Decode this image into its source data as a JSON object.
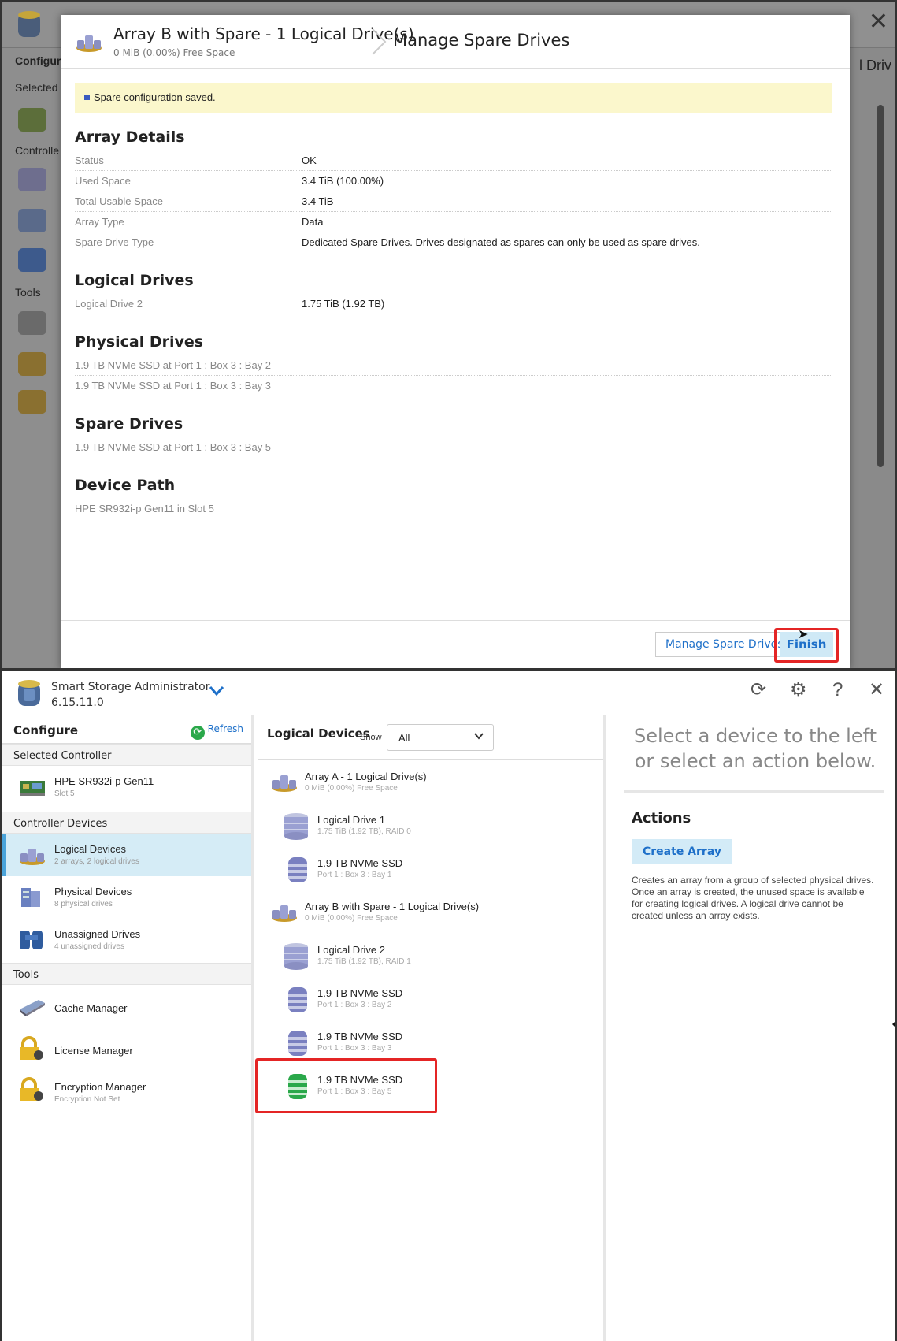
{
  "modal": {
    "title": "Array B with Spare - 1 Logical Drive(s)",
    "subtitle": "0 MiB (0.00%) Free Space",
    "step": "Manage Spare Drives",
    "notice": "Spare configuration saved.",
    "sections": {
      "array_details": "Array Details",
      "logical_drives": "Logical Drives",
      "physical_drives": "Physical Drives",
      "spare_drives": "Spare Drives",
      "device_path": "Device Path"
    },
    "details": [
      {
        "k": "Status",
        "v": "OK"
      },
      {
        "k": "Used Space",
        "v": "3.4 TiB (100.00%)"
      },
      {
        "k": "Total Usable Space",
        "v": "3.4 TiB"
      },
      {
        "k": "Array Type",
        "v": "Data"
      },
      {
        "k": "Spare Drive Type",
        "v": "Dedicated Spare Drives. Drives designated as spares can only be used as spare drives."
      }
    ],
    "logical": [
      {
        "k": "Logical Drive 2",
        "v": "1.75 TiB (1.92 TB)"
      }
    ],
    "physical": [
      "1.9 TB NVMe SSD at Port 1 : Box 3 : Bay 2",
      "1.9 TB NVMe SSD at Port 1 : Box 3 : Bay 3"
    ],
    "spare": [
      "1.9 TB NVMe SSD at Port 1 : Box 3 : Bay 5"
    ],
    "device_path": "HPE SR932i-p Gen11 in Slot 5",
    "buttons": {
      "manage": "Manage Spare Drives",
      "finish": "Finish"
    }
  },
  "background": {
    "header_left": "Configur",
    "selected": "Selected",
    "controller": "Controlle",
    "tools": "Tools",
    "right_text": "l Driv"
  },
  "app": {
    "name": "Smart Storage Administrator",
    "version": "6.15.11.0",
    "left": {
      "title": "Configure",
      "refresh": "Refresh",
      "selected_controller": "Selected Controller",
      "controller": {
        "name": "HPE SR932i-p Gen11",
        "desc": "Slot 5"
      },
      "controller_devices": "Controller Devices",
      "devices": [
        {
          "name": "Logical Devices",
          "desc": "2 arrays, 2 logical drives"
        },
        {
          "name": "Physical Devices",
          "desc": "8 physical drives"
        },
        {
          "name": "Unassigned Drives",
          "desc": "4 unassigned drives"
        }
      ],
      "tools_title": "Tools",
      "tools": [
        {
          "name": "Cache Manager",
          "desc": ""
        },
        {
          "name": "License Manager",
          "desc": ""
        },
        {
          "name": "Encryption Manager",
          "desc": "Encryption Not Set"
        }
      ]
    },
    "mid": {
      "title": "Logical Devices",
      "show": "Show",
      "filter": "All",
      "items": [
        {
          "name": "Array A - 1 Logical Drive(s)",
          "desc": "0 MiB (0.00%) Free Space"
        },
        {
          "name": "Logical Drive 1",
          "desc": "1.75 TiB (1.92 TB), RAID 0"
        },
        {
          "name": "1.9 TB NVMe SSD",
          "desc": "Port 1 : Box 3 : Bay 1"
        },
        {
          "name": "Array B with Spare - 1 Logical Drive(s)",
          "desc": "0 MiB (0.00%) Free Space"
        },
        {
          "name": "Logical Drive 2",
          "desc": "1.75 TiB (1.92 TB), RAID 1"
        },
        {
          "name": "1.9 TB NVMe SSD",
          "desc": "Port 1 : Box 3 : Bay 2"
        },
        {
          "name": "1.9 TB NVMe SSD",
          "desc": "Port 1 : Box 3 : Bay 3"
        },
        {
          "name": "1.9 TB NVMe SSD",
          "desc": "Port 1 : Box 3 : Bay 5"
        }
      ]
    },
    "right": {
      "message": "Select a device to the left or select an action below.",
      "actions_title": "Actions",
      "create_array": "Create Array",
      "description": "Creates an array from a group of selected physical drives. Once an array is created, the unused space is available for creating logical drives. A logical drive cannot be created unless an array exists."
    }
  },
  "colors": {
    "accent": "#1e70c9",
    "highlight": "#e42525",
    "notice_bg": "#fbf7cc",
    "selected_bg": "#d5ecf6"
  }
}
